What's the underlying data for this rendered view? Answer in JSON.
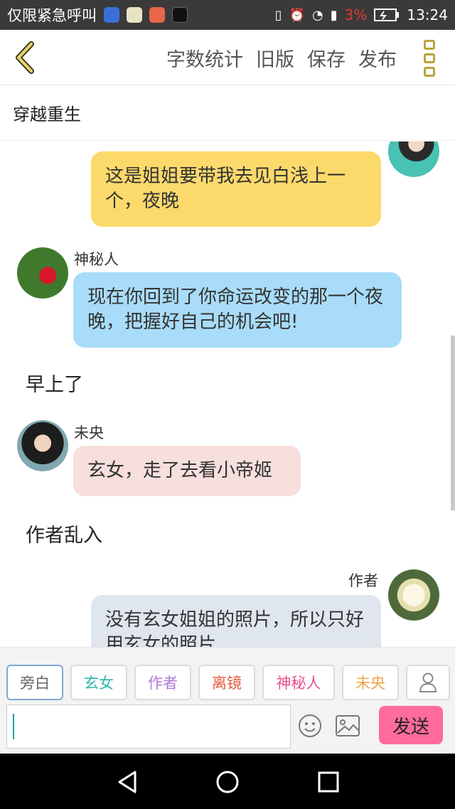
{
  "status_bar": {
    "carrier": "仅限紧急呼叫",
    "battery_percent": "3%",
    "time": "13:24"
  },
  "top_bar": {
    "actions": [
      "字数统计",
      "旧版",
      "保存",
      "发布"
    ]
  },
  "story_title": "穿越重生",
  "chat": {
    "messages": [
      {
        "speaker": "",
        "text": "这是姐姐要带我去见白浅上一个，夜晚"
      },
      {
        "speaker": "神秘人",
        "text": "现在你回到了你命运改变的那一个夜晚，把握好自己的机会吧!"
      },
      {
        "narration": "早上了"
      },
      {
        "speaker": "未央",
        "text": "玄女，走了去看小帝姬"
      },
      {
        "narration": "作者乱入"
      },
      {
        "speaker": "作者",
        "text": "没有玄女姐姐的照片，所以只好用玄女的照片"
      }
    ]
  },
  "composer": {
    "roles": [
      "旁白",
      "玄女",
      "作者",
      "离镜",
      "神秘人",
      "未央"
    ],
    "role_colors": [
      "#666666",
      "#2bb5a8",
      "#b27ad8",
      "#e35b3a",
      "#e84f8f",
      "#f0a24a"
    ],
    "send_label": "发送"
  },
  "colors": {
    "accent_gold": "#b5a53b",
    "send_button": "#ff6b9e",
    "bubble_yellow": "#fcd96b",
    "bubble_blue": "#a8dcf8",
    "bubble_pink": "#f6dfdd",
    "bubble_gray": "#dfe6ee"
  }
}
